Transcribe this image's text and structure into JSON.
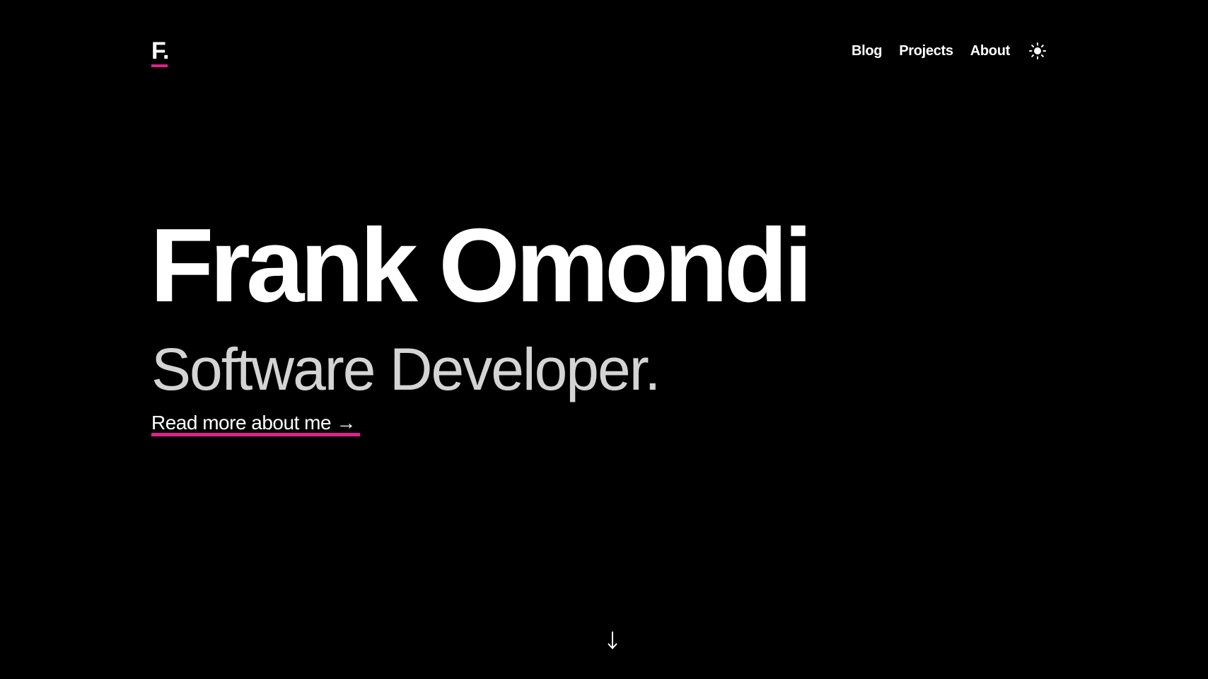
{
  "header": {
    "logo": "F.",
    "nav": [
      {
        "label": "Blog"
      },
      {
        "label": "Projects"
      },
      {
        "label": "About"
      }
    ],
    "theme_toggle_icon": "sun-icon"
  },
  "hero": {
    "name": "Frank Omondi",
    "role": "Software Developer.",
    "cta_label": "Read more about me →"
  },
  "scroll_icon": "arrow-down-icon",
  "colors": {
    "background": "#000000",
    "text": "#ffffff",
    "subtitle": "#d4d4d4",
    "accent": "#e0218a"
  }
}
